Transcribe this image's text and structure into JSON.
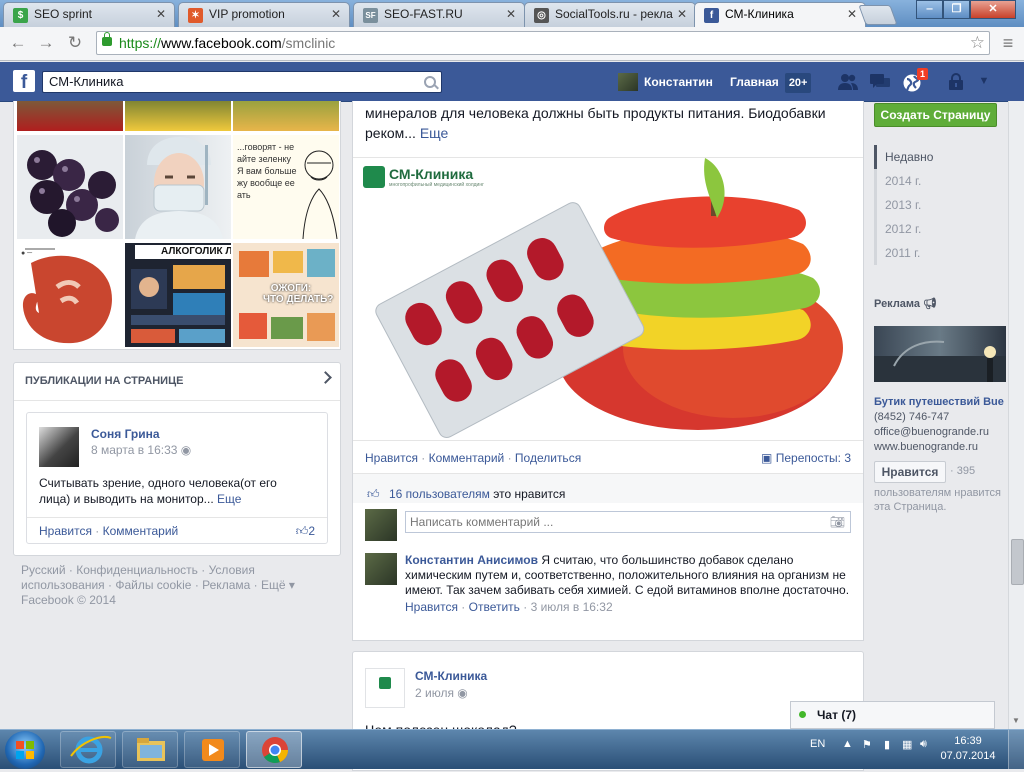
{
  "browser": {
    "tabs": [
      {
        "label": "SEO sprint",
        "active": false,
        "favicon_color": "#3aa44a",
        "favicon_glyph": "$"
      },
      {
        "label": "VIP promotion",
        "active": false,
        "favicon_color": "#e05a2b",
        "favicon_glyph": "✶"
      },
      {
        "label": "SEO-FAST.RU",
        "active": false,
        "favicon_color": "#7a8f9c",
        "favicon_glyph": "SF"
      },
      {
        "label": "SocialTools.ru - рекла",
        "active": false,
        "favicon_color": "#555555",
        "favicon_glyph": "◎"
      },
      {
        "label": "СМ-Клиника",
        "active": true,
        "favicon_color": "#3b5998",
        "favicon_glyph": "f"
      }
    ],
    "window_controls": {
      "minimize": "‒",
      "maximize": "❐",
      "close": "✕"
    },
    "url": {
      "scheme": "https://",
      "host": "www.facebook.com",
      "path": "/smclinic"
    }
  },
  "fb_header": {
    "logo": "f",
    "search_value": "СМ-Клиника",
    "user_name": "Константин",
    "home_label": "Главная",
    "home_count": "20+",
    "notification_count": "1"
  },
  "left": {
    "publications_title": "ПУБЛИКАЦИИ НА СТРАНИЦЕ",
    "pub_card": {
      "author": "Соня Грина",
      "date": "8 марта в 16:33",
      "text": "Считывать зрение, одного человека(от его лица) и выводить на монитор...",
      "more": "Еще",
      "like": "Нравится",
      "comment": "Комментарий",
      "likes_count": "2"
    },
    "photo_texts": {
      "meme1": "...говорят - не\nайте зеленку\nЯ вам больше\nжу вообще ее\nать",
      "alco_title": "АЛКОГОЛИК ЛИ",
      "burns": "ОЖОГИ:\nЧТО ДЕЛАТЬ?"
    },
    "footer": {
      "links": [
        "Русский",
        "Конфиденциальность",
        "Условия использования",
        "Файлы cookie",
        "Реклама",
        "Ещё"
      ],
      "copyright": "Facebook © 2014"
    }
  },
  "post": {
    "text_line1": "минералов для человека должны быть продукты питания. Биодобавки",
    "text_line2": "реком...",
    "more": "Еще",
    "image_brand": "СМ-Клиника",
    "image_brand_sub": "многопрофильный медицинский холдинг",
    "actions": {
      "like": "Нравится",
      "comment": "Комментарий",
      "share": "Поделиться"
    },
    "shares": "Перепосты: 3",
    "likes_count_link": "16 пользователям",
    "likes_suffix": "это нравится",
    "comment_placeholder": "Написать комментарий ...",
    "comment": {
      "author": "Константин Анисимов",
      "text": "Я считаю, что большинство добавок сделано химическим путем и, соответственно, положительного влияния на организм не имеют. Так зачем забивать себя химией. С едой витаминов вполне достаточно.",
      "like": "Нравится",
      "reply": "Ответить",
      "date": "3 июля в 16:32"
    }
  },
  "post2": {
    "author": "СМ-Клиника",
    "date": "2 июля",
    "text_partial": "Чем полезен шоколад?"
  },
  "right": {
    "create_page": "Создать Страницу",
    "years": [
      "Недавно",
      "2014 г.",
      "2013 г.",
      "2012 г.",
      "2011 г."
    ],
    "ad_header": "Реклама",
    "ad": {
      "title": "Бутик путешествий Bue",
      "phone": "(8452) 746-747",
      "email": "office@buenogrande.ru",
      "site": "www.buenogrande.ru",
      "like_button": "Нравится",
      "like_count": "395",
      "like_text": "пользователям нравится эта Страница."
    }
  },
  "chat": {
    "label": "Чат (7)"
  },
  "taskbar": {
    "lang": "EN",
    "time": "16:39",
    "date": "07.07.2014"
  }
}
